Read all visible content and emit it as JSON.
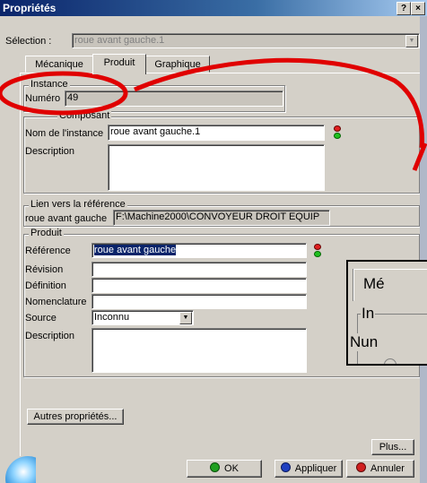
{
  "window": {
    "title": "Propriétés",
    "help_btn": "?",
    "close_btn": "×"
  },
  "selection": {
    "label": "Sélection :",
    "value": "roue avant gauche.1"
  },
  "tabs": [
    {
      "label": "Mécanique"
    },
    {
      "label": "Produit"
    },
    {
      "label": "Graphique"
    }
  ],
  "instance": {
    "group_label": "Instance",
    "numero_label": "Numéro",
    "numero_value": "49"
  },
  "composant": {
    "group_label": "Composant",
    "nom_label": "Nom de l'instance",
    "nom_value": "roue avant gauche.1",
    "description_label": "Description",
    "description_value": ""
  },
  "lien": {
    "group_label": "Lien vers la référence",
    "name": "roue avant gauche",
    "path": "F:\\Machine2000\\CONVOYEUR DROIT EQUIP"
  },
  "produit": {
    "group_label": "Produit",
    "reference_label": "Référence",
    "reference_value": "roue avant gauche",
    "revision_label": "Révision",
    "revision_value": "",
    "definition_label": "Définition",
    "definition_value": "",
    "nomenclature_label": "Nomenclature",
    "nomenclature_value": "",
    "source_label": "Source",
    "source_value": "Inconnu",
    "description_label": "Description",
    "description_value": ""
  },
  "buttons": {
    "autres": "Autres propriétés...",
    "plus": "Plus...",
    "ok": "OK",
    "appliquer": "Appliquer",
    "annuler": "Annuler"
  },
  "zoom_inset": {
    "tab_label": "Mé",
    "instance_label": "In",
    "numero_label": "Nun"
  },
  "colors": {
    "annotation_red": "#e00000",
    "selection_blue": "#0a246a",
    "ok_green": "#20a020",
    "appliquer_blue": "#2040c0",
    "annuler_red": "#d02020"
  }
}
